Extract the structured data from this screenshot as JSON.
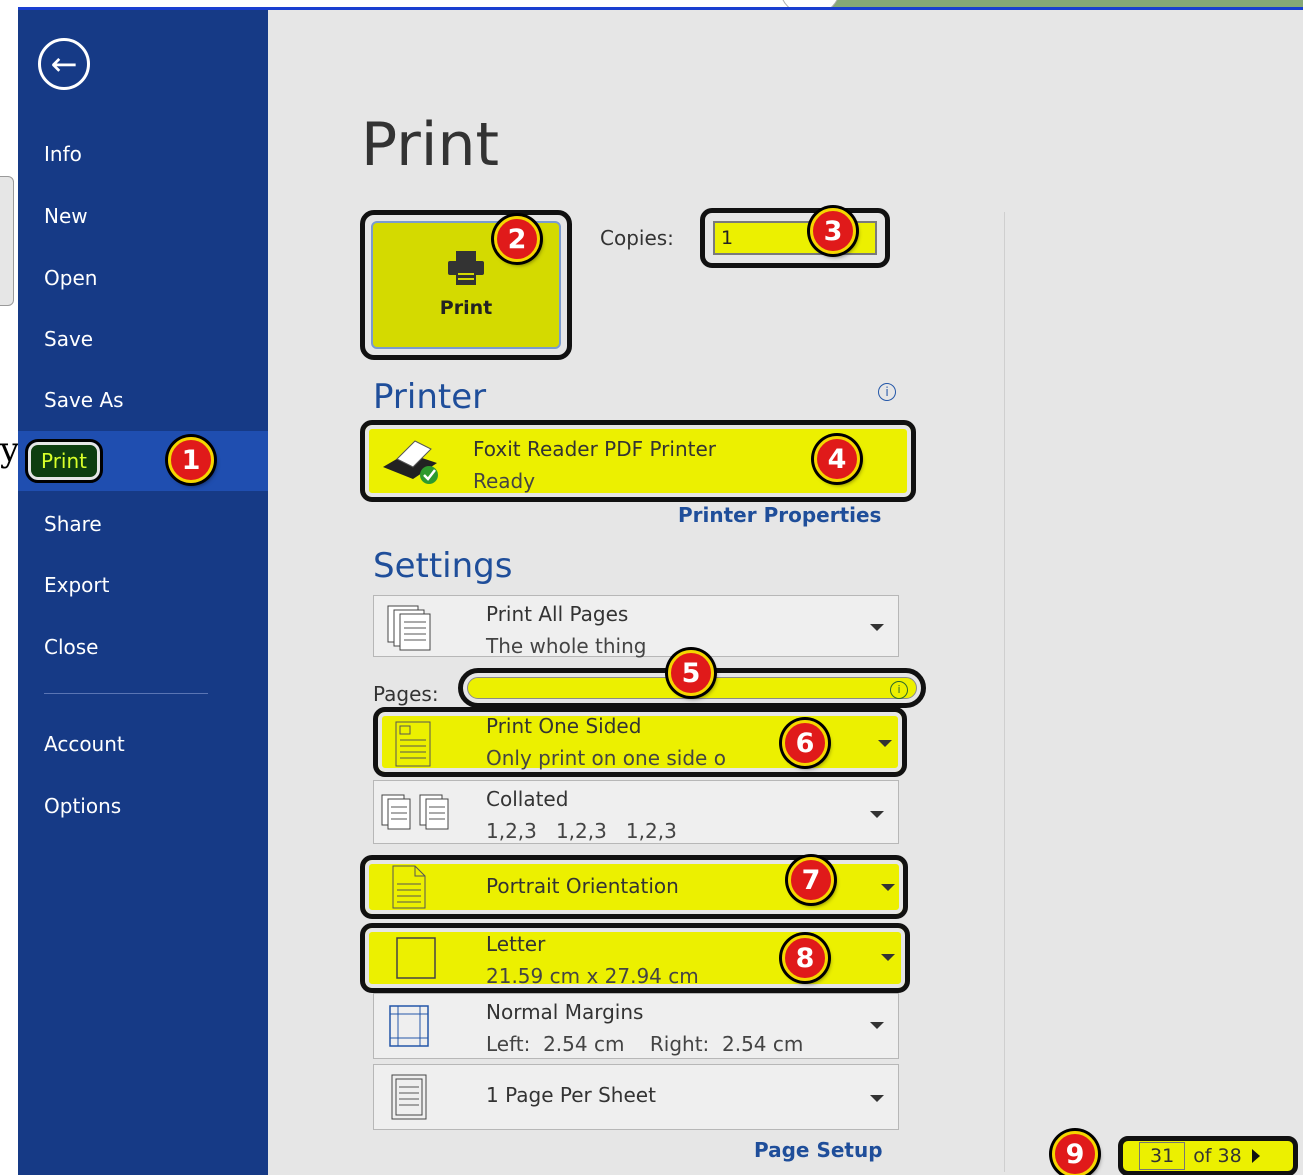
{
  "backstage": {
    "nav": [
      {
        "label": "Info"
      },
      {
        "label": "New"
      },
      {
        "label": "Open"
      },
      {
        "label": "Save"
      },
      {
        "label": "Save As"
      },
      {
        "label": "Print"
      },
      {
        "label": "Share"
      },
      {
        "label": "Export"
      },
      {
        "label": "Close"
      }
    ],
    "nav_bottom": [
      {
        "label": "Account"
      },
      {
        "label": "Options"
      }
    ],
    "active": "Print"
  },
  "page_title": "Print",
  "print_button": {
    "label": "Print"
  },
  "copies": {
    "label": "Copies:",
    "value": "1"
  },
  "printer": {
    "heading": "Printer",
    "name": "Foxit Reader PDF Printer",
    "status": "Ready",
    "properties_link": "Printer Properties"
  },
  "settings": {
    "heading": "Settings",
    "range": {
      "title": "Print All Pages",
      "subtitle": "The whole thing"
    },
    "pages_label": "Pages:",
    "pages_value": "",
    "sides": {
      "title": "Print One Sided",
      "subtitle": "Only print on one side o"
    },
    "collation": {
      "title": "Collated",
      "subtitle": "1,2,3   1,2,3   1,2,3"
    },
    "orientation": {
      "title": "Portrait Orientation"
    },
    "paper": {
      "title": "Letter",
      "subtitle": "21.59 cm x 27.94 cm"
    },
    "margins": {
      "title": "Normal Margins",
      "subtitle": "Left:  2.54 cm    Right:  2.54 cm"
    },
    "per_sheet": {
      "title": "1 Page Per Sheet"
    },
    "page_setup_link": "Page Setup"
  },
  "preview_pager": {
    "current": "31",
    "total": "of 38"
  },
  "callouts": [
    "1",
    "2",
    "3",
    "4",
    "5",
    "6",
    "7",
    "8",
    "9"
  ],
  "outside_fragment": "y",
  "colors": {
    "sidebar": "#163a86",
    "highlight": "#ecf000",
    "callout": "#e01a1a",
    "heading": "#1f4e9a"
  }
}
